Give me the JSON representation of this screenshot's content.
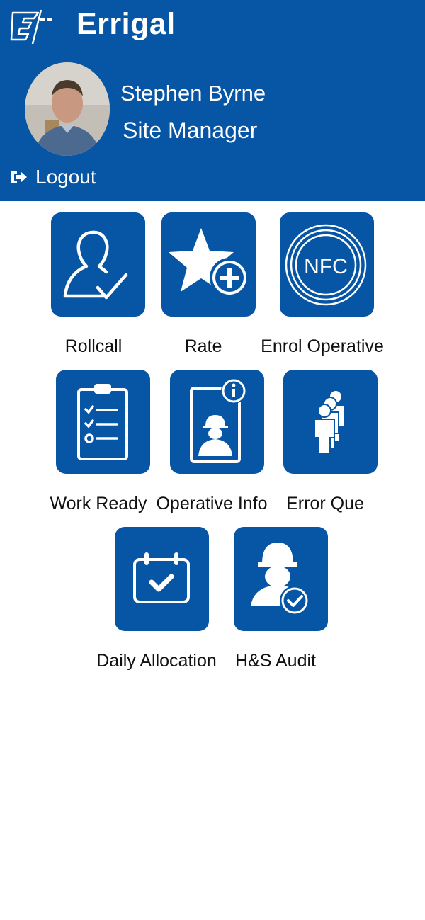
{
  "app": {
    "brand": "Errigal"
  },
  "user": {
    "name": "Stephen Byrne",
    "role": "Site Manager"
  },
  "logout": {
    "label": "Logout"
  },
  "menu": [
    {
      "label": "Rollcall",
      "icon": "person-check-icon"
    },
    {
      "label": "Rate",
      "icon": "star-plus-icon"
    },
    {
      "label": "Enrol Operative",
      "icon": "nfc-icon"
    },
    {
      "label": "Work Ready",
      "icon": "clipboard-checklist-icon"
    },
    {
      "label": "Operative Info",
      "icon": "worker-info-icon"
    },
    {
      "label": "Error Que",
      "icon": "people-queue-icon"
    },
    {
      "label": "Daily Allocation",
      "icon": "calendar-check-icon"
    },
    {
      "label": "H&S Audit",
      "icon": "worker-check-icon"
    }
  ],
  "icon_text": {
    "nfc": "NFC"
  },
  "colors": {
    "primary": "#0755a5",
    "text": "#111111",
    "background": "#ffffff"
  }
}
